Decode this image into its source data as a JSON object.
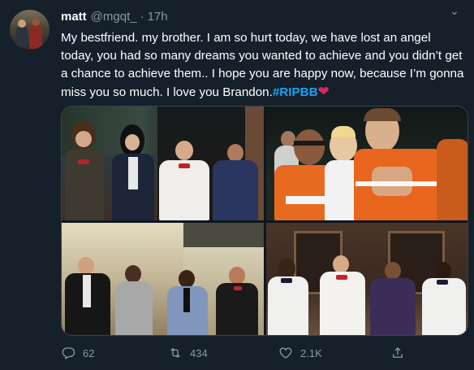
{
  "tweet": {
    "author_name": "matt",
    "author_handle": "@mgqt_",
    "separator": "·",
    "time": "17h",
    "text_main": "My bestfriend. my brother. I am so hurt today, we have lost an angel today, you had so many dreams you wanted to achieve and you didn’t get a chance to achieve them.. I hope you are happy now, because I’m gonna miss you so much. I love you Brandon.",
    "hashtag": "#RIPBB",
    "emoji": "❤",
    "more_glyph": "⌄"
  },
  "actions": {
    "reply_count": "62",
    "retweet_count": "434",
    "like_count": "2.1K"
  },
  "icons": [
    "reply-icon",
    "retweet-icon",
    "like-icon",
    "share-icon",
    "more-chevron-icon"
  ],
  "colors": {
    "background": "#15202b",
    "secondary_text": "#8899a6",
    "hashtag": "#1da1f2",
    "heart": "#e0245e",
    "border": "#38444d"
  }
}
